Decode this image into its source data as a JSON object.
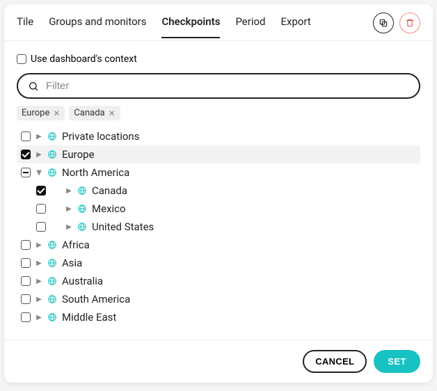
{
  "tabs": {
    "items": [
      {
        "label": "Tile"
      },
      {
        "label": "Groups and monitors"
      },
      {
        "label": "Checkpoints"
      },
      {
        "label": "Period"
      },
      {
        "label": "Export"
      }
    ],
    "activeIndex": 2
  },
  "context_checkbox": {
    "label": "Use dashboard's context",
    "checked": false
  },
  "filter": {
    "placeholder": "Filter",
    "value": ""
  },
  "chips": [
    {
      "label": "Europe"
    },
    {
      "label": "Canada"
    }
  ],
  "tree": [
    {
      "label": "Private locations",
      "level": 1,
      "state": "unchecked",
      "expanded": false,
      "selected": false
    },
    {
      "label": "Europe",
      "level": 1,
      "state": "checked",
      "expanded": false,
      "selected": true
    },
    {
      "label": "North America",
      "level": 1,
      "state": "indeterminate",
      "expanded": true,
      "selected": false
    },
    {
      "label": "Canada",
      "level": 2,
      "state": "checked",
      "expanded": false,
      "selected": false
    },
    {
      "label": "Mexico",
      "level": 2,
      "state": "unchecked",
      "expanded": false,
      "selected": false
    },
    {
      "label": "United States",
      "level": 2,
      "state": "unchecked",
      "expanded": false,
      "selected": false
    },
    {
      "label": "Africa",
      "level": 1,
      "state": "unchecked",
      "expanded": false,
      "selected": false
    },
    {
      "label": "Asia",
      "level": 1,
      "state": "unchecked",
      "expanded": false,
      "selected": false
    },
    {
      "label": "Australia",
      "level": 1,
      "state": "unchecked",
      "expanded": false,
      "selected": false
    },
    {
      "label": "South America",
      "level": 1,
      "state": "unchecked",
      "expanded": false,
      "selected": false
    },
    {
      "label": "Middle East",
      "level": 1,
      "state": "unchecked",
      "expanded": false,
      "selected": false
    }
  ],
  "footer": {
    "cancel": "CANCEL",
    "set": "SET"
  },
  "colors": {
    "accent": "#17c2c2",
    "danger": "#f28b82"
  }
}
